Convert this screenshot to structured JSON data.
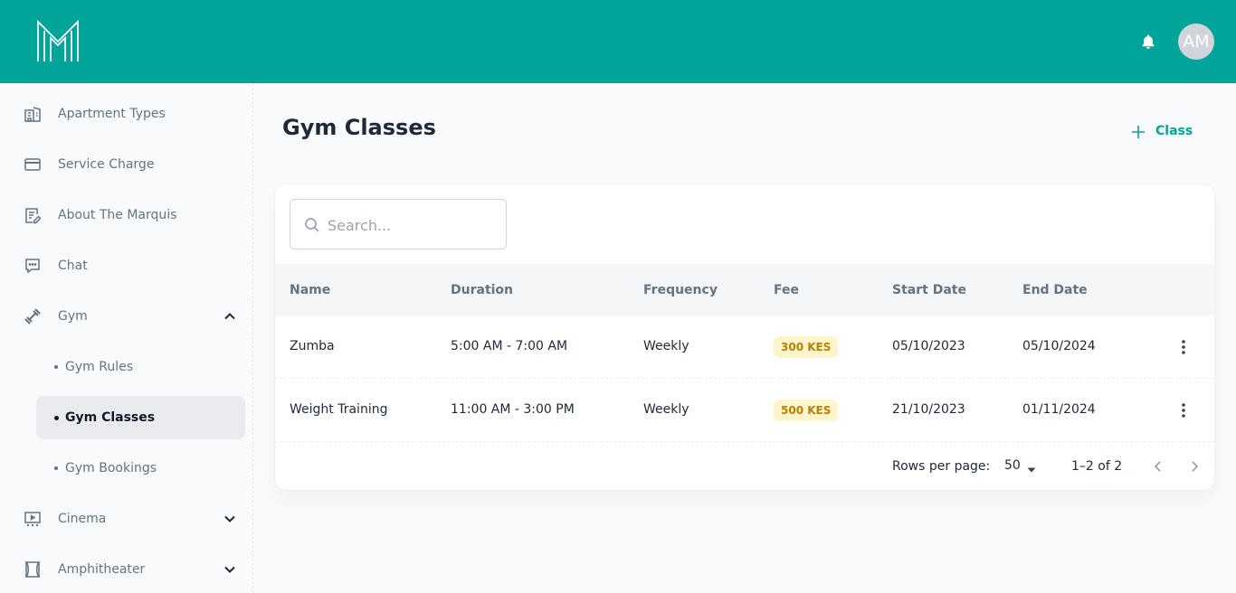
{
  "header": {
    "logo_icon": "marquis-m-logo",
    "notification_icon": "bell-icon",
    "avatar_initials": "AM",
    "brand_color": "#00a499"
  },
  "sidebar": {
    "items": [
      {
        "label": "Apartment Types",
        "icon": "building-icon"
      },
      {
        "label": "Service Charge",
        "icon": "credit-card-icon"
      },
      {
        "label": "About The Marquis",
        "icon": "document-edit-icon"
      },
      {
        "label": "Chat",
        "icon": "chat-icon"
      },
      {
        "label": "Gym",
        "icon": "dumbbell-icon",
        "expanded": true,
        "children": [
          {
            "label": "Gym Rules"
          },
          {
            "label": "Gym Classes",
            "active": true
          },
          {
            "label": "Gym Bookings"
          }
        ]
      },
      {
        "label": "Cinema",
        "icon": "cinema-icon",
        "expanded": false
      },
      {
        "label": "Amphitheater",
        "icon": "amphitheater-icon",
        "expanded": false
      }
    ]
  },
  "page": {
    "title": "Gym Classes",
    "add_button_label": "Class"
  },
  "search": {
    "placeholder": "Search...",
    "value": ""
  },
  "table": {
    "columns": [
      "Name",
      "Duration",
      "Frequency",
      "Fee",
      "Start Date",
      "End Date"
    ],
    "rows": [
      {
        "name": "Zumba",
        "duration": "5:00 AM - 7:00 AM",
        "frequency": "Weekly",
        "fee": "300 KES",
        "start_date": "05/10/2023",
        "end_date": "05/10/2024"
      },
      {
        "name": "Weight Training",
        "duration": "11:00 AM - 3:00 PM",
        "frequency": "Weekly",
        "fee": "500 KES",
        "start_date": "21/10/2023",
        "end_date": "01/11/2024"
      }
    ]
  },
  "pagination": {
    "rows_per_page_label": "Rows per page:",
    "rows_per_page": "50",
    "range": "1–2 of 2"
  }
}
